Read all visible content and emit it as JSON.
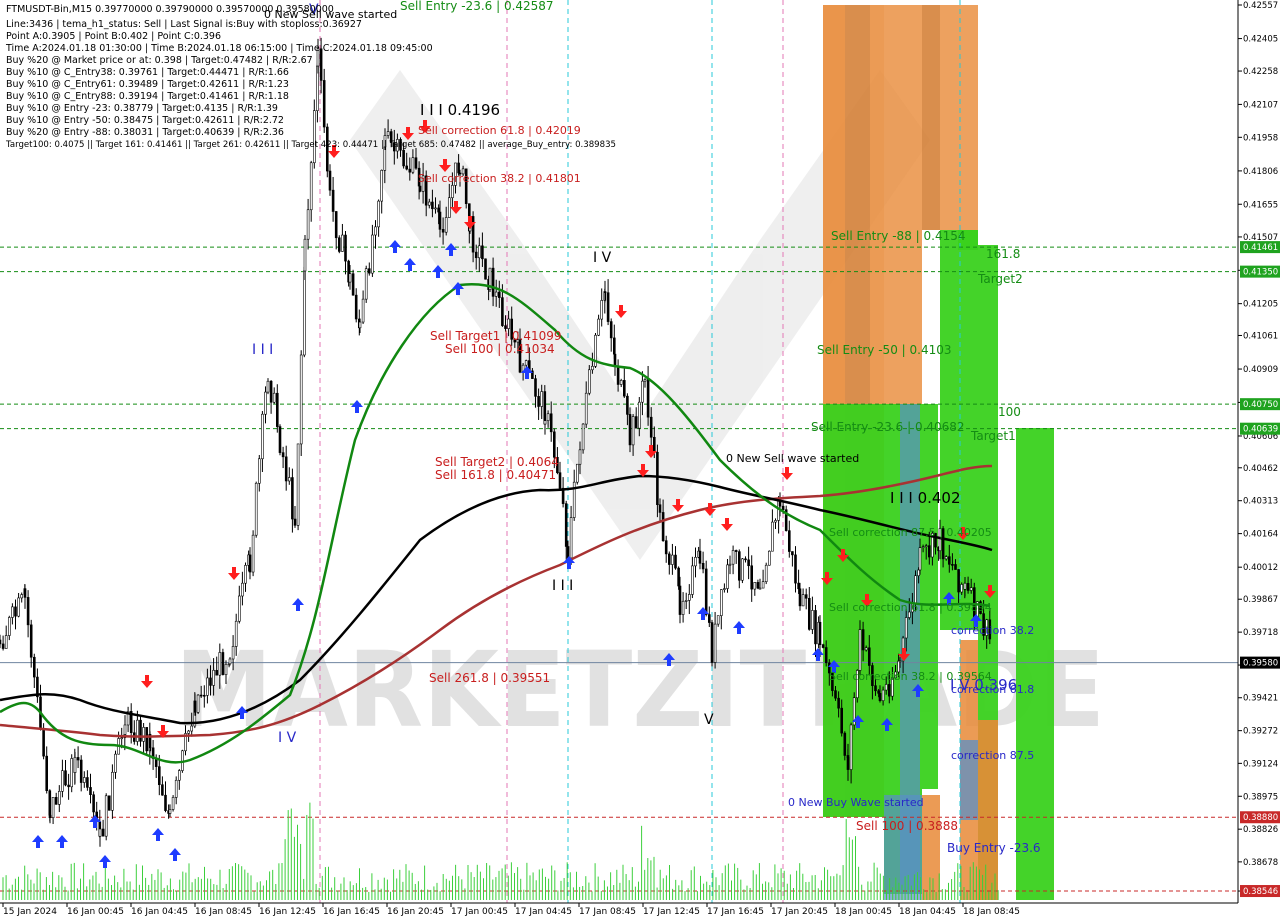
{
  "colors": {
    "background": "#ffffff",
    "candle": "#000000",
    "ma_green": "#118811",
    "ma_black": "#000000",
    "ma_red": "#a83232",
    "level_line": "#148c14",
    "last_price_line": "#6f84a0",
    "sell_text": "#c81e1e",
    "buy_text": "#2828c8",
    "zone_orange": "#e88a37",
    "zone_orange_dark": "#d27a2e",
    "zone_green": "#3ad11d",
    "zone_blue": "#5a8fc8",
    "vline_pink": "#e377b5",
    "vline_cyan": "#27c8d8",
    "volume": "#3ccf3c",
    "arrow_up": "#1e3cff",
    "arrow_down": "#ff1e1e",
    "watermark": "#bdbdbd",
    "price_tag_green": "#1fa31f",
    "price_tag_red": "#c82828",
    "price_tag_black": "#000000"
  },
  "header": {
    "title": "FTMUSDT-Bin,M15  0.39770000 0.39790000 0.39570000 0.39580000",
    "new_sell_wave_note": "0 New Sell wave started",
    "info_lines": [
      "Line:3436  |  tema_h1_status: Sell  |  Last Signal is:Buy with stoploss:0.36927",
      "Point A:0.3905  |  Point B:0.402  |  Point C:0.396",
      "Time A:2024.01.18 01:30:00  |  Time B:2024.01.18 06:15:00  |  Time C:2024.01.18 09:45:00",
      "Buy %20 @ Market price or at: 0.398  |  Target:0.47482  |  R/R:2.67",
      "Buy %10 @ C_Entry38: 0.39761  |  Target:0.44471  |  R/R:1.66",
      "Buy %10 @ C_Entry61: 0.39489  |  Target:0.42611  |  R/R:1.23",
      "Buy %10 @ C_Entry88: 0.39194  |  Target:0.41461  |  R/R:1.18",
      "Buy %10 @ Entry -23: 0.38779  |  Target:0.4135  |  R/R:1.39",
      "Buy %10 @ Entry -50: 0.38475  |  Target:0.42611  |  R/R:2.72",
      "Buy %20 @ Entry -88: 0.38031  |  Target:0.40639  |  R/R:2.36",
      "Target100: 0.4075  ||  Target 161: 0.41461  ||  Target 261: 0.42611  ||  Target 423: 0.44471  ||  Target 685: 0.47482  ||  average_Buy_entry: 0.389835"
    ]
  },
  "watermark": "MARKETZITRADE",
  "price_axis": {
    "labels": [
      "0.42557",
      "0.42405",
      "0.42258",
      "0.42107",
      "0.41958",
      "0.41806",
      "0.41655",
      "0.41507",
      "0.41356",
      "0.41205",
      "0.41061",
      "0.40909",
      "0.40758",
      "0.40606",
      "0.40462",
      "0.40313",
      "0.40164",
      "0.40012",
      "0.39867",
      "0.39718",
      "0.39569",
      "0.39421",
      "0.39272",
      "0.39124",
      "0.38975",
      "0.38826",
      "0.38678",
      "0.38546"
    ],
    "tags": [
      {
        "text": "0.41461",
        "price": 0.41461,
        "style": "green"
      },
      {
        "text": "0.41350",
        "price": 0.4135,
        "style": "green"
      },
      {
        "text": "0.40750",
        "price": 0.4075,
        "style": "green"
      },
      {
        "text": "0.40639",
        "price": 0.40639,
        "style": "green"
      },
      {
        "text": "0.39580",
        "price": 0.3958,
        "style": "black"
      },
      {
        "text": "0.38880",
        "price": 0.3888,
        "style": "red"
      },
      {
        "text": "0.38546",
        "price": 0.38546,
        "style": "red"
      }
    ]
  },
  "time_axis": {
    "labels": [
      "15 Jan 2024",
      "16 Jan 00:45",
      "16 Jan 04:45",
      "16 Jan 08:45",
      "16 Jan 12:45",
      "16 Jan 16:45",
      "16 Jan 20:45",
      "17 Jan 00:45",
      "17 Jan 04:45",
      "17 Jan 08:45",
      "17 Jan 12:45",
      "17 Jan 16:45",
      "17 Jan 20:45",
      "18 Jan 00:45",
      "18 Jan 04:45",
      "18 Jan 08:45"
    ]
  },
  "annotations": [
    {
      "text": "Sell Entry -23.6 | 0.42587",
      "color": "green"
    },
    {
      "text": "I I I 0.4196",
      "color": "black"
    },
    {
      "text": "Sell correction 61.8 | 0.42019",
      "color": "sell"
    },
    {
      "text": "Sell correction 38.2 | 0.41801",
      "color": "sell"
    },
    {
      "text": "I V",
      "color": "buy"
    },
    {
      "text": "I I I",
      "color": "buy"
    },
    {
      "text": "V",
      "color": "buy"
    },
    {
      "text": "I V",
      "color": "buy"
    },
    {
      "text": "Sell Target1 | 0.41099",
      "color": "sell"
    },
    {
      "text": "Sell 100 | 0.41034",
      "color": "sell"
    },
    {
      "text": "Sell Target2 | 0.4064",
      "color": "sell"
    },
    {
      "text": "Sell 161.8 | 0.40471",
      "color": "sell"
    },
    {
      "text": "I I I",
      "color": "black"
    },
    {
      "text": "Sell  261.8 | 0.39551",
      "color": "sell"
    },
    {
      "text": "V",
      "color": "black"
    },
    {
      "text": "0 New Sell wave started",
      "color": "black"
    },
    {
      "text": "Sell Entry -88 | 0.4154",
      "color": "green"
    },
    {
      "text": "Sell Entry -50 | 0.4103",
      "color": "green"
    },
    {
      "text": "Sell Entry -23.6 | 0.40682",
      "color": "green"
    },
    {
      "text": "I I I 0.402",
      "color": "black"
    },
    {
      "text": "Sell correction 87.5 | 0.40205",
      "color": "green"
    },
    {
      "text": "Sell correction 61.8 | 0.39894",
      "color": "green"
    },
    {
      "text": "Sell correction 38.2 | 0.39564",
      "color": "green"
    },
    {
      "text": "161.8",
      "color": "green"
    },
    {
      "text": "Target2",
      "color": "green"
    },
    {
      "text": "100",
      "color": "green"
    },
    {
      "text": "Target1",
      "color": "green"
    },
    {
      "text": "correction 38.2",
      "color": "buy"
    },
    {
      "text": "I V 0.396",
      "color": "buy"
    },
    {
      "text": "correction 61.8",
      "color": "buy"
    },
    {
      "text": "correction 87.5",
      "color": "buy"
    },
    {
      "text": "0 New Buy Wave started",
      "color": "buy"
    },
    {
      "text": "Sell 100 | 0.3888",
      "color": "sell"
    },
    {
      "text": "Buy Entry -23.6",
      "color": "buy"
    }
  ]
}
